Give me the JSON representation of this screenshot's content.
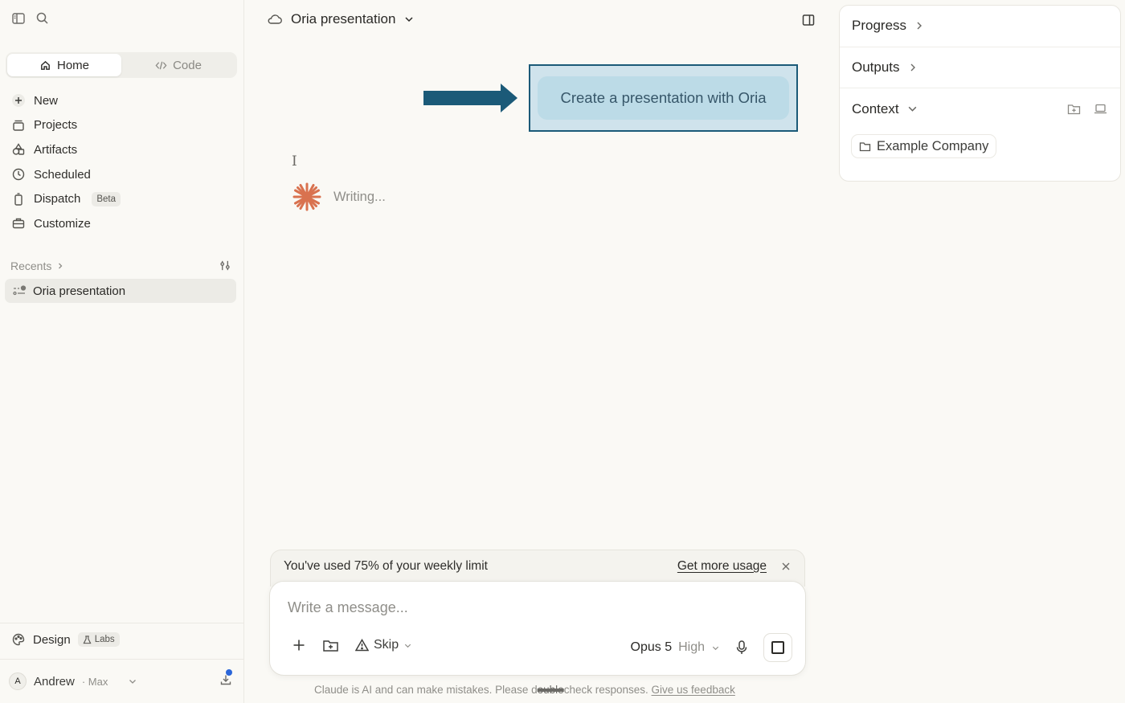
{
  "sidebar": {
    "modes": [
      {
        "label": "Home",
        "icon": "home-icon",
        "active": true
      },
      {
        "label": "Code",
        "icon": "code-icon",
        "active": false
      }
    ],
    "nav": [
      {
        "label": "New",
        "icon": "plus-icon"
      },
      {
        "label": "Projects",
        "icon": "projects-icon"
      },
      {
        "label": "Artifacts",
        "icon": "artifacts-icon"
      },
      {
        "label": "Scheduled",
        "icon": "clock-icon"
      },
      {
        "label": "Dispatch",
        "icon": "dispatch-icon",
        "badge": "Beta"
      },
      {
        "label": "Customize",
        "icon": "briefcase-icon"
      }
    ],
    "recents_label": "Recents",
    "recents": [
      {
        "label": "Oria presentation",
        "icon": "task-icon"
      }
    ],
    "design": {
      "label": "Design",
      "badge": "Labs"
    },
    "user": {
      "initial": "A",
      "name": "Andrew",
      "plan": "· Max"
    }
  },
  "main": {
    "title": "Oria presentation",
    "prompt": "Create a presentation with Oria",
    "status": "Writing...",
    "usage": {
      "text": "You've used 75% of your weekly limit",
      "link": "Get more usage"
    },
    "composer": {
      "placeholder": "Write a message...",
      "permission": "Skip",
      "model": "Opus 5",
      "effort": "High"
    },
    "disclaimer_prefix": "Claude is AI and can make mistakes. Please d",
    "disclaimer_strike": "ouble",
    "disclaimer_suffix": "check responses.",
    "feedback": "Give us feedback"
  },
  "panel": {
    "progress": "Progress",
    "outputs": "Outputs",
    "context": "Context",
    "context_item": "Example Company"
  },
  "colors": {
    "accent_highlight_border": "#1b5a78",
    "arrow": "#1b5a78",
    "spinner": "#d9724f",
    "notification_dot": "#2b66d9"
  }
}
